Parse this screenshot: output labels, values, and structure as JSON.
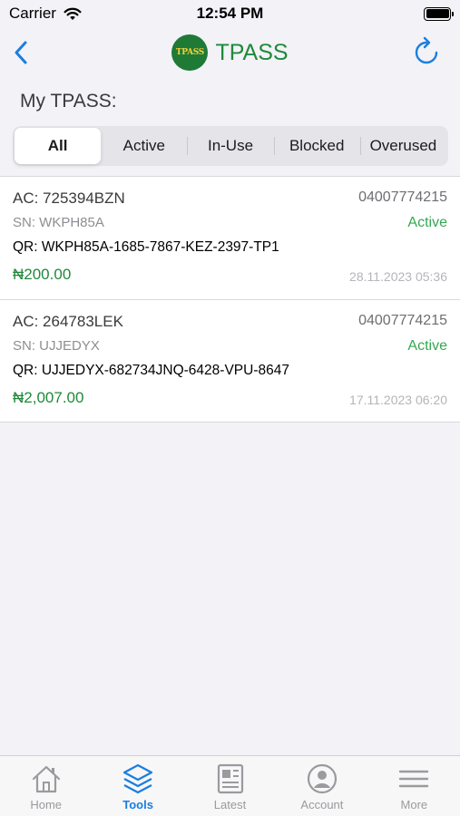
{
  "status_bar": {
    "carrier": "Carrier",
    "time": "12:54 PM"
  },
  "nav": {
    "logo_text": "TPASS",
    "title": "TPASS"
  },
  "section_title": "My TPASS:",
  "segments": [
    {
      "label": "All",
      "selected": true
    },
    {
      "label": "Active",
      "selected": false
    },
    {
      "label": "In-Use",
      "selected": false
    },
    {
      "label": "Blocked",
      "selected": false
    },
    {
      "label": "Overused",
      "selected": false
    }
  ],
  "cards": [
    {
      "ac": "AC: 725394BZN",
      "phone": "04007774215",
      "sn": "SN: WKPH85A",
      "status": "Active",
      "qr": "QR: WKPH85A-1685-7867-KEZ-2397-TP1",
      "amount": "₦200.00",
      "date": "28.11.2023 05:36"
    },
    {
      "ac": "AC: 264783LEK",
      "phone": "04007774215",
      "sn": "SN: UJJEDYX",
      "status": "Active",
      "qr": "QR: UJJEDYX-682734JNQ-6428-VPU-8647",
      "amount": "₦2,007.00",
      "date": "17.11.2023 06:20"
    }
  ],
  "tabs": [
    {
      "label": "Home",
      "icon": "home-icon"
    },
    {
      "label": "Tools",
      "icon": "layers-icon",
      "active": true
    },
    {
      "label": "Latest",
      "icon": "news-icon"
    },
    {
      "label": "Account",
      "icon": "account-icon"
    },
    {
      "label": "More",
      "icon": "menu-icon"
    }
  ],
  "colors": {
    "accent": "#1a7ee0",
    "brand_green": "#1f8a3a",
    "status_active": "#34a853",
    "background": "#f2f2f7"
  }
}
